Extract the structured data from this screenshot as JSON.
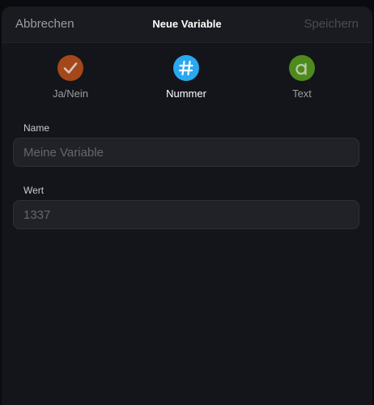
{
  "header": {
    "cancel_label": "Abbrechen",
    "title": "Neue Variable",
    "save_label": "Speichern"
  },
  "types": [
    {
      "label": "Ja/Nein",
      "icon": "checkmark-icon",
      "color": "#a4471a",
      "selected": false
    },
    {
      "label": "Nummer",
      "icon": "hash-icon",
      "color": "#2aa8f0",
      "selected": true
    },
    {
      "label": "Text",
      "icon": "letter-a-icon",
      "color": "#4f8a1c",
      "selected": false
    }
  ],
  "form": {
    "name": {
      "label": "Name",
      "value": "",
      "placeholder": "Meine Variable"
    },
    "value": {
      "label": "Wert",
      "value": "",
      "placeholder": "1337"
    }
  }
}
